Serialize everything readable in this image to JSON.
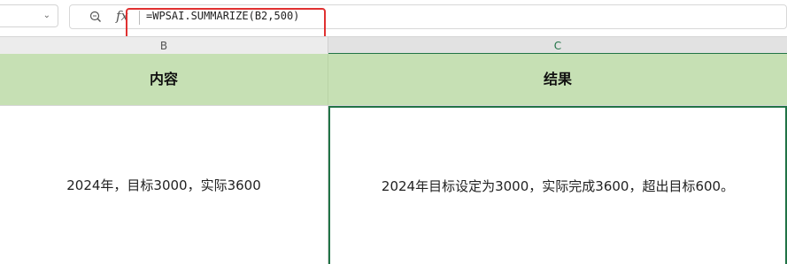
{
  "formula_bar": {
    "formula": "=WPSAI.SUMMARIZE(B2,500)"
  },
  "columns": {
    "b_label": "B",
    "c_label": "C"
  },
  "header_row": {
    "b": "内容",
    "c": "结果"
  },
  "data_row": {
    "b": "2024年，目标3000，实际3600",
    "c": "2024年目标设定为3000，实际完成3600，超出目标600。"
  },
  "colors": {
    "header_fill": "#c6e0b4",
    "selection_border": "#217346",
    "highlight": "#e03131"
  }
}
